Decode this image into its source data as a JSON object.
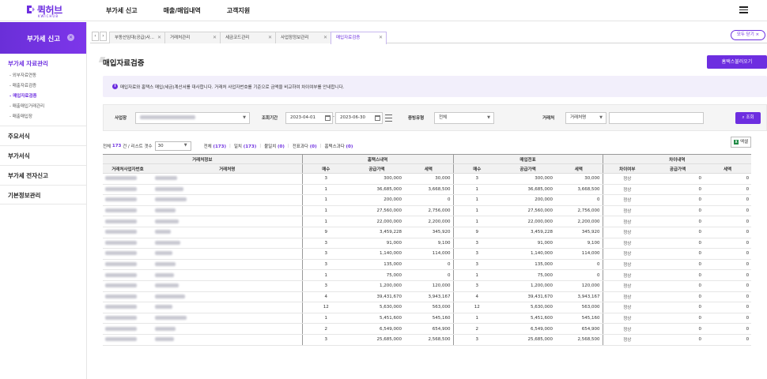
{
  "brand": {
    "name": "퀵허브",
    "sub": "KWICHUB",
    "color": "#6d2ee0"
  },
  "topnav": [
    "부가세 신고",
    "매출/매입내역",
    "고객지원"
  ],
  "sidebar": {
    "header": "부가세 신고",
    "section_title": "부가세 자료관리",
    "sub_items": [
      {
        "label": "- 외부자료연동",
        "active": false
      },
      {
        "label": "- 매출자료검증",
        "active": false
      },
      {
        "label": "- 매입자료검증",
        "active": true
      },
      {
        "label": "- 매출매입거래관리",
        "active": false
      },
      {
        "label": "- 매출매입장",
        "active": false
      }
    ],
    "menus": [
      "주요서식",
      "부가서식",
      "부가세 전자신고",
      "기본정보관리"
    ]
  },
  "tabs": [
    {
      "label": "부동산임대(공급)사...",
      "active": false
    },
    {
      "label": "거래처관리",
      "active": false
    },
    {
      "label": "세금코드관리",
      "active": false
    },
    {
      "label": "사업장정보관리",
      "active": false
    },
    {
      "label": "매입자료검증",
      "active": true
    }
  ],
  "close_all_label": "모두 닫기 ×",
  "page": {
    "title": "매입자료검증",
    "hometax_button": "홈택스불러오기",
    "notice": "매입자료와 홈택스 매입(세금)계산서를 대사합니다. 거래처 사업자번호를 기준으로 금액을 비교하여 차이여부를 안내합니다."
  },
  "filters": {
    "biz_label": "사업장",
    "period_label": "조회기간",
    "date_from": "2023-04-01",
    "date_sep": "-",
    "date_to": "2023-06-30",
    "evidence_label": "증빙유형",
    "evidence_value": "전체",
    "partner_label": "거래처",
    "partner_type": "거래처명",
    "search_button": "조회"
  },
  "summary": {
    "total_prefix": "전체",
    "total_count": "173",
    "total_suffix": "건 / 리스트 갯수",
    "per_page": "30",
    "filters": [
      {
        "label": "전체",
        "count": "(173)"
      },
      {
        "label": "일치",
        "count": "(173)"
      },
      {
        "label": "불일치",
        "count": "(0)"
      },
      {
        "label": "전표과다",
        "count": "(0)"
      },
      {
        "label": "홈택스과다",
        "count": "(0)"
      }
    ],
    "excel_button": "엑셀"
  },
  "table": {
    "groups": [
      "거래처정보",
      "홈택스내역",
      "매입전표",
      "차이내역"
    ],
    "columns": [
      "거래처사업자번호",
      "거래처명",
      "매수",
      "공급가액",
      "세액",
      "매수",
      "공급가액",
      "세액",
      "차이여부",
      "공급가액",
      "세액"
    ],
    "rows": [
      [
        "3",
        "300,000",
        "30,000",
        "3",
        "300,000",
        "30,000",
        "정상",
        "0",
        "0"
      ],
      [
        "1",
        "36,685,000",
        "3,668,500",
        "1",
        "36,685,000",
        "3,668,500",
        "정상",
        "0",
        "0"
      ],
      [
        "1",
        "200,000",
        "0",
        "1",
        "200,000",
        "0",
        "정상",
        "0",
        "0"
      ],
      [
        "1",
        "27,560,000",
        "2,756,000",
        "1",
        "27,560,000",
        "2,756,000",
        "정상",
        "0",
        "0"
      ],
      [
        "1",
        "22,000,000",
        "2,200,000",
        "1",
        "22,000,000",
        "2,200,000",
        "정상",
        "0",
        "0"
      ],
      [
        "9",
        "3,459,228",
        "345,920",
        "9",
        "3,459,228",
        "345,920",
        "정상",
        "0",
        "0"
      ],
      [
        "3",
        "91,000",
        "9,100",
        "3",
        "91,000",
        "9,100",
        "정상",
        "0",
        "0"
      ],
      [
        "3",
        "1,140,000",
        "114,000",
        "3",
        "1,140,000",
        "114,000",
        "정상",
        "0",
        "0"
      ],
      [
        "3",
        "135,000",
        "0",
        "3",
        "135,000",
        "0",
        "정상",
        "0",
        "0"
      ],
      [
        "1",
        "75,000",
        "0",
        "1",
        "75,000",
        "0",
        "정상",
        "0",
        "0"
      ],
      [
        "3",
        "1,200,000",
        "120,000",
        "3",
        "1,200,000",
        "120,000",
        "정상",
        "0",
        "0"
      ],
      [
        "4",
        "39,431,670",
        "3,943,167",
        "4",
        "39,431,670",
        "3,943,167",
        "정상",
        "0",
        "0"
      ],
      [
        "12",
        "5,630,000",
        "563,000",
        "12",
        "5,630,000",
        "563,000",
        "정상",
        "0",
        "0"
      ],
      [
        "1",
        "5,451,600",
        "545,160",
        "1",
        "5,451,600",
        "545,160",
        "정상",
        "0",
        "0"
      ],
      [
        "2",
        "6,549,000",
        "654,900",
        "2",
        "6,549,000",
        "654,900",
        "정상",
        "0",
        "0"
      ],
      [
        "3",
        "25,685,000",
        "2,568,500",
        "3",
        "25,685,000",
        "2,568,500",
        "정상",
        "0",
        "0"
      ]
    ]
  }
}
